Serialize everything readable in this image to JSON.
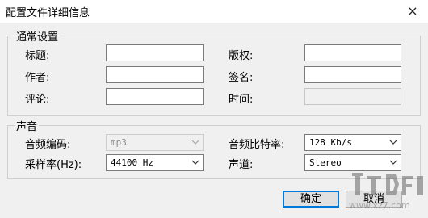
{
  "window": {
    "title": "配置文件详细信息",
    "close_icon": "×"
  },
  "general": {
    "legend": "通常设置",
    "title_label": "标题:",
    "author_label": "作者:",
    "comment_label": "评论:",
    "copyright_label": "版权:",
    "signature_label": "签名:",
    "time_label": "时间:",
    "title_value": "",
    "author_value": "",
    "comment_value": "",
    "copyright_value": "",
    "signature_value": "",
    "time_value": ""
  },
  "audio": {
    "legend": "声音",
    "encoding_label": "音频编码:",
    "encoding_value": "mp3",
    "bitrate_label": "音频比特率:",
    "bitrate_value": "128 Kb/s",
    "samplerate_label": "采样率(Hz):",
    "samplerate_value": "44100 Hz",
    "channel_label": "声道:",
    "channel_value": "Stereo"
  },
  "buttons": {
    "ok": "确定",
    "cancel": "取消"
  },
  "watermark": {
    "text": "www.xz7.com"
  }
}
